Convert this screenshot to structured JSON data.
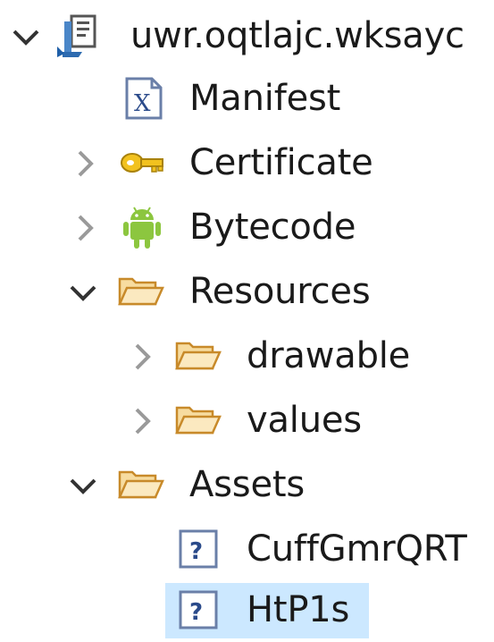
{
  "tree": {
    "root": {
      "label": "uwr.oqtlajc.wksayc",
      "icon": "apk-project-icon",
      "expanded": true
    },
    "items": [
      {
        "label": "Manifest",
        "icon": "xml-file-icon",
        "expanded": null
      },
      {
        "label": "Certificate",
        "icon": "key-icon",
        "expanded": false
      },
      {
        "label": "Bytecode",
        "icon": "android-icon",
        "expanded": false
      },
      {
        "label": "Resources",
        "icon": "folder-open-icon",
        "expanded": true
      },
      {
        "label": "drawable",
        "icon": "folder-open-icon",
        "expanded": false
      },
      {
        "label": "values",
        "icon": "folder-open-icon",
        "expanded": false
      },
      {
        "label": "Assets",
        "icon": "folder-open-icon",
        "expanded": true
      },
      {
        "label": "CuffGmrQRT",
        "icon": "unknown-file-icon",
        "expanded": null
      },
      {
        "label": "HtP1s",
        "icon": "unknown-file-icon",
        "expanded": null,
        "selected": true
      }
    ]
  },
  "colors": {
    "selection": "#cce8ff",
    "folder": "#e8b25a",
    "android": "#8cc63f",
    "key": "#e8b81a"
  }
}
